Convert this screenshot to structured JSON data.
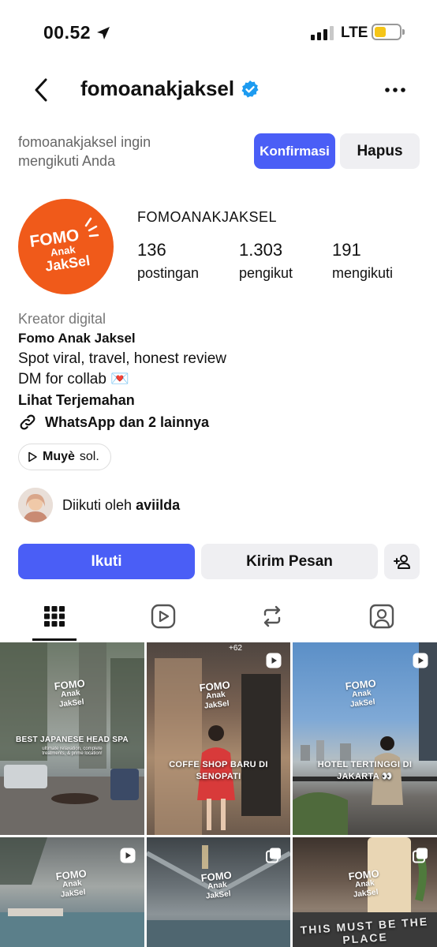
{
  "status_bar": {
    "time": "00.52",
    "network": "LTE"
  },
  "header": {
    "username": "fomoanakjaksel"
  },
  "follow_request": {
    "text": "fomoanakjaksel ingin mengikuti Anda",
    "confirm_label": "Konfirmasi",
    "delete_label": "Hapus"
  },
  "profile": {
    "display_name": "FOMOANAKJAKSEL",
    "avatar_logo": {
      "line1": "FOMO",
      "line2": "Anak",
      "line3": "JakSel"
    },
    "stats": [
      {
        "value": "136",
        "label": "postingan"
      },
      {
        "value": "1.303",
        "label": "pengikut"
      },
      {
        "value": "191",
        "label": "mengikuti"
      }
    ],
    "category": "Kreator digital",
    "bio_name": "Fomo Anak Jaksel",
    "bio_lines": [
      "Spot viral, travel, honest review",
      "DM for collab 💌"
    ],
    "see_translation": "Lihat Terjemahan",
    "links_label": "WhatsApp dan 2 lainnya",
    "music": {
      "artist": "Muyè",
      "track": "sol."
    },
    "followed_by_prefix": "Diikuti oleh",
    "followed_by_name": "aviilda"
  },
  "actions": {
    "follow_label": "Ikuti",
    "message_label": "Kirim Pesan"
  },
  "tabs": [
    "grid-icon",
    "reels-icon",
    "reposts-icon",
    "tagged-icon"
  ],
  "posts": [
    {
      "title": "BEST JAPANESE HEAD SPA",
      "subtitle": "ultimate relaxation, complete treatments, & prime location!",
      "logo": [
        "FOMO",
        "Anak",
        "JakSel"
      ],
      "type": "image"
    },
    {
      "title": "COFFE SHOP BARU DI SENOPATI",
      "subtitle": "",
      "logo": [
        "FOMO",
        "Anak",
        "JakSel"
      ],
      "type": "reel",
      "count": "+62"
    },
    {
      "title": "HOTEL TERTINGGI DI JAKARTA 👀",
      "subtitle": "",
      "logo": [
        "FOMO",
        "Anak",
        "JakSel"
      ],
      "type": "reel"
    },
    {
      "title": "",
      "subtitle": "",
      "logo": [
        "FOMO",
        "Anak",
        "JakSel"
      ],
      "type": "reel"
    },
    {
      "title": "",
      "subtitle": "",
      "logo": [
        "FOMO",
        "Anak",
        "JakSel"
      ],
      "type": "carousel"
    },
    {
      "title": "THIS MUST BE THE PLACE",
      "subtitle": "",
      "logo": [
        "FOMO",
        "Anak",
        "JakSel"
      ],
      "type": "carousel"
    }
  ],
  "colors": {
    "primary": "#4a5ef6",
    "avatar_bg": "#f05a1a",
    "verified": "#1d9bf0",
    "secondary_btn": "#efeff2"
  }
}
